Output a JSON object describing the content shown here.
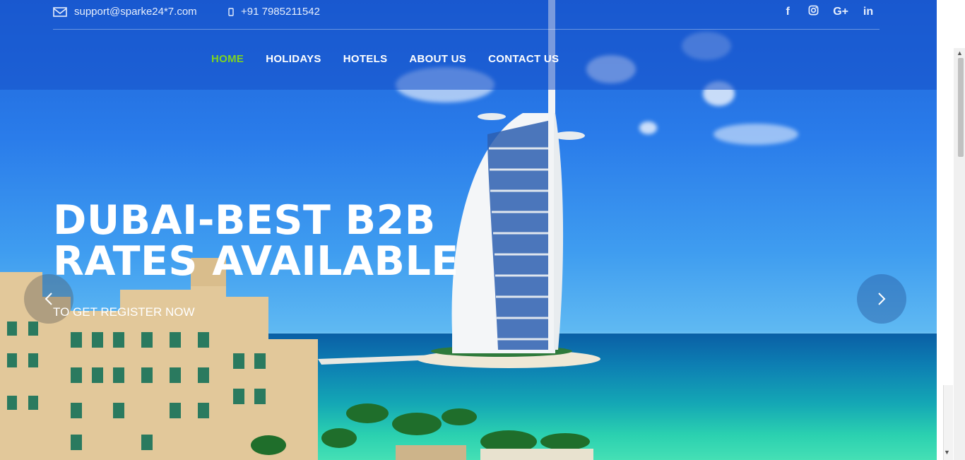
{
  "topbar": {
    "email": "support@sparke24*7.com",
    "phone": "+91 7985211542",
    "email_icon": "envelope-icon",
    "phone_icon": "mobile-phone-icon",
    "social": [
      {
        "icon": "facebook-icon",
        "glyph": "f"
      },
      {
        "icon": "instagram-icon",
        "glyph": ""
      },
      {
        "icon": "google-plus-icon",
        "glyph": "G+"
      },
      {
        "icon": "linkedin-icon",
        "glyph": "in"
      }
    ]
  },
  "nav": {
    "items": [
      {
        "label": "HOME",
        "active": true
      },
      {
        "label": "HOLIDAYS",
        "active": false
      },
      {
        "label": "HOTELS",
        "active": false
      },
      {
        "label": "ABOUT US",
        "active": false
      },
      {
        "label": "CONTACT US",
        "active": false
      }
    ],
    "active_color": "#7ed321"
  },
  "hero": {
    "headline_line1": "DUBAI-BEST B2B",
    "headline_line2": "RATES AVAILABLE",
    "subline": "TO GET REGISTER NOW",
    "prev_icon": "chevron-left-icon",
    "next_icon": "chevron-right-icon"
  }
}
